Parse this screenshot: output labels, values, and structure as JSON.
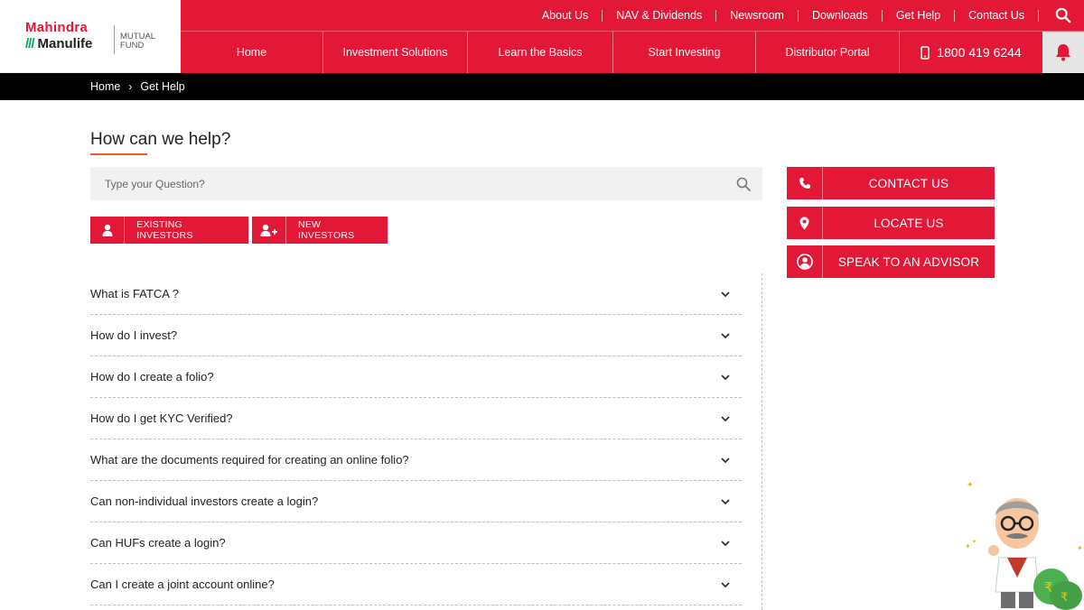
{
  "header": {
    "logo": {
      "brand_top": "Mahindra",
      "brand_bottom": "Manulife",
      "fund_line1": "MUTUAL",
      "fund_line2": "FUND"
    },
    "top_links": [
      "About Us",
      "NAV & Dividends",
      "Newsroom",
      "Downloads",
      "Get Help",
      "Contact Us"
    ],
    "nav": {
      "home": "Home",
      "investment_solutions": "Investment Solutions",
      "learn_basics": "Learn the Basics",
      "start_investing": "Start Investing",
      "distributor_portal": "Distributor Portal",
      "phone": "1800 419 6244"
    }
  },
  "breadcrumb": {
    "home": "Home",
    "separator": "›",
    "current": "Get Help"
  },
  "main": {
    "title": "How can we help?",
    "search": {
      "placeholder": "Type your Question?"
    },
    "buttons": {
      "existing": "EXISTING INVESTORS",
      "new": "NEW INVESTORS"
    },
    "faqs": [
      "What is FATCA ?",
      "How do I invest?",
      "How do I create a folio?",
      "How do I get KYC Verified?",
      "What are the documents required for creating an online folio?",
      "Can non-individual investors create a login?",
      "Can HUFs create a login?",
      "Can I create a joint account online?"
    ]
  },
  "actions": {
    "contact": "CONTACT US",
    "locate": "LOCATE US",
    "advisor": "SPEAK TO AN ADVISOR"
  },
  "colors": {
    "brand_red": "#e31837",
    "accent_orange": "#e8612c",
    "breadcrumb_bg": "#000000",
    "search_bg": "#f1f1f1"
  }
}
